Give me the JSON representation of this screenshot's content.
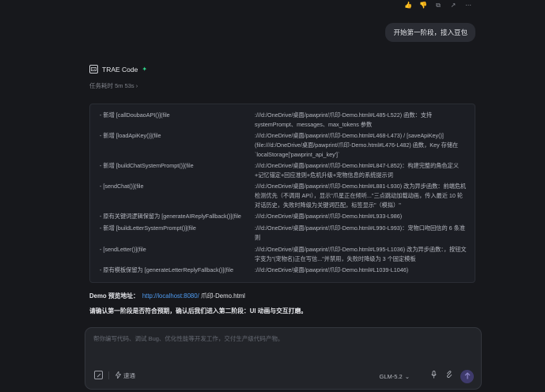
{
  "top_actions": {
    "icon_names": [
      "like-icon",
      "dislike-icon",
      "copy-icon",
      "share-icon",
      "more-icon"
    ],
    "glyphs": [
      "👍",
      "👎",
      "⧉",
      "↗",
      "⋯"
    ]
  },
  "user_message": "开始第一阶段，接入豆包",
  "agent": {
    "name": "TRAE Code",
    "elapsed": "任务耗时 5m 53s",
    "elapsed_chevron": "›"
  },
  "changes": [
    {
      "left": "- 新增 [callDoubaoAPI()](file",
      "right": ":///d:/OneDrive/桌面/pawprint/爪印-Demo.html#L485-L522) 函数：支持 systemPrompt、messages、max_tokens 参数"
    },
    {
      "left": "- 新增 [loadApiKey()](file",
      "right": ":///d:/OneDrive/桌面/pawprint/爪印-Demo.html#L468-L473) / [saveApiKey()](file:///d:/OneDrive/桌面/pawprint/爪印-Demo.html#L476-L482) 函数，Key 存储在 `localStorage['pawprint_api_key']`"
    },
    {
      "left": "- 新增 [buildChatSystemPrompt()](file",
      "right": ":///d:/OneDrive/桌面/pawprint/爪印-Demo.html#L847-L852)：构建完整的角色定义+记忆锚定+回应准则+危机升级+宠物信息的系统提示词"
    },
    {
      "left": "- [sendChat()](file",
      "right": ":///d:/OneDrive/桌面/pawprint/爪印-Demo.html#L881-L930) 改为异步函数：前端危机检测优先（不调用 API），显示\"爪星正在倾听...\"三点跳动加载动画，传入最近 10 轮对话历史，失败时降级为关键词匹配，标签显示\"（模拟）\""
    },
    {
      "left": "- 原有关键词逻辑保留为 [generateAIReplyFallback()](file",
      "right": ":///d:/OneDrive/桌面/pawprint/爪印-Demo.html#L933-L986)"
    },
    {
      "left": "- 新增 [buildLetterSystemPrompt()](file",
      "right": ":///d:/OneDrive/桌面/pawprint/爪印-Demo.html#L990-L993)：宠物口吻回信的 6 条准则"
    },
    {
      "left": "- [sendLetter()](file",
      "right": ":///d:/OneDrive/桌面/pawprint/爪印-Demo.html#L995-L1036) 改为异步函数：，按钮文字变为\"(宠物名)正在写信...\"并禁用，失败时降级为 3 个固定模板"
    },
    {
      "left": "- 原有模板保留为 [generateLetterReplyFallback()](file",
      "right": ":///d:/OneDrive/桌面/pawprint/爪印-Demo.html#L1039-L1046)"
    }
  ],
  "demo": {
    "label": "Demo 预览地址：",
    "link": "http://localhost:8080/",
    "file": " 爪印-Demo.html"
  },
  "confirm": "请确认第一阶段是否符合预期，确认后我们进入第二阶段：UI 动画与交互打磨。",
  "composer": {
    "placeholder": "帮你编写代码、调试 Bug、优化性能等开发工作，交付生产级代码产物。",
    "fast_label": "速通",
    "model": "GLM-5.2",
    "model_chevron": "⌄"
  },
  "colors": {
    "background": "#17181c",
    "accent": "#4f9cf2",
    "sparkle": "#2fd48a",
    "send_button": "#3e3a6b"
  }
}
